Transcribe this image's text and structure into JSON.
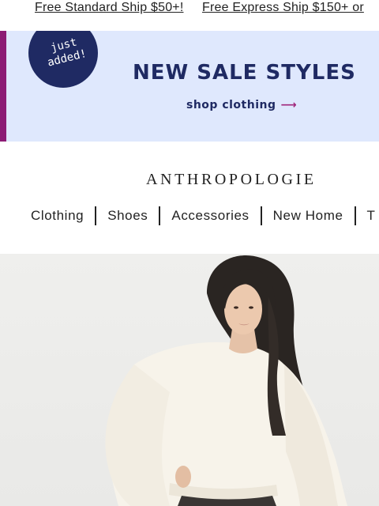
{
  "shipping_bar": {
    "standard": "Free Standard Ship $50+!",
    "express": "Free Express Ship $150+ or"
  },
  "banner": {
    "badge_line1": "just",
    "badge_line2": "added!",
    "title": "NEW SALE STYLES",
    "cta": "shop clothing",
    "cta_arrow": "⟶"
  },
  "header": {
    "logo": "ANTHROPOLOGIE"
  },
  "nav": {
    "items": [
      {
        "label": "Clothing"
      },
      {
        "label": "Shoes"
      },
      {
        "label": "Accessories"
      },
      {
        "label": "New Home"
      },
      {
        "label": "T"
      }
    ]
  },
  "colors": {
    "banner_bg": "#dfe8fd",
    "brand_navy": "#1f2a63",
    "accent_plum": "#8c1b74",
    "hero_bg": "#ececea"
  },
  "hero": {
    "image": "woman-in-cream-sweater-photo"
  }
}
